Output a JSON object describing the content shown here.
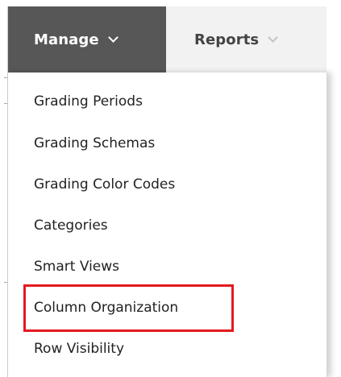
{
  "menubar": {
    "manage_label": "Manage",
    "reports_label": "Reports"
  },
  "dropdown": {
    "items": [
      {
        "label": "Grading Periods"
      },
      {
        "label": "Grading Schemas"
      },
      {
        "label": "Grading Color Codes"
      },
      {
        "label": "Categories"
      },
      {
        "label": "Smart Views"
      },
      {
        "label": "Column Organization",
        "highlighted": true
      },
      {
        "label": "Row Visibility"
      }
    ]
  },
  "colors": {
    "manage_background": "#575757",
    "menubar_background": "#f2f2f2",
    "highlight_border": "#e3191f",
    "text": "#222222"
  }
}
